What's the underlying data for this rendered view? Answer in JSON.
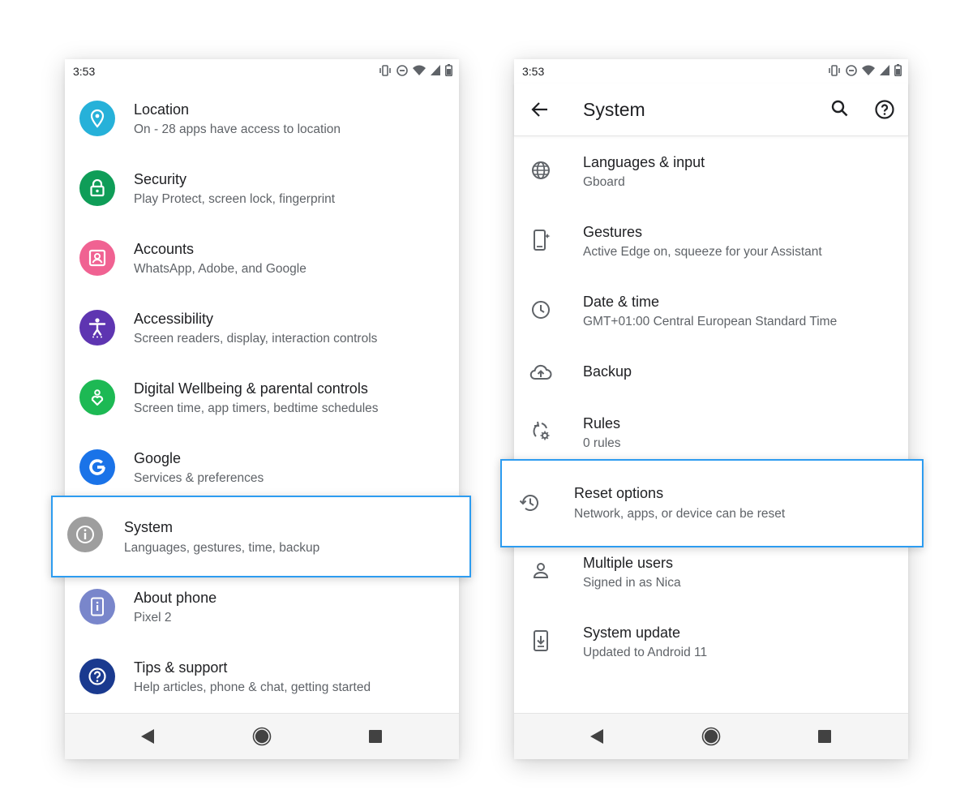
{
  "left_screen": {
    "status_time": "3:53",
    "items": [
      {
        "title": "Location",
        "subtitle": "On - 28 apps have access to location",
        "icon": "location-pin-icon",
        "color": "#26b1d9"
      },
      {
        "title": "Security",
        "subtitle": "Play Protect, screen lock, fingerprint",
        "icon": "lock-icon",
        "color": "#0f9d58"
      },
      {
        "title": "Accounts",
        "subtitle": "WhatsApp, Adobe, and Google",
        "icon": "account-box-icon",
        "color": "#f06292"
      },
      {
        "title": "Accessibility",
        "subtitle": "Screen readers, display, interaction controls",
        "icon": "accessibility-icon",
        "color": "#5e35b1"
      },
      {
        "title": "Digital Wellbeing & parental controls",
        "subtitle": "Screen time, app timers, bedtime schedules",
        "icon": "wellbeing-heart-icon",
        "color": "#1db954"
      },
      {
        "title": "Google",
        "subtitle": "Services & preferences",
        "icon": "google-g-icon",
        "color": "#1a73e8"
      },
      {
        "title": "System",
        "subtitle": "Languages, gestures, time, backup",
        "icon": "info-icon",
        "color": "#9e9e9e"
      },
      {
        "title": "About phone",
        "subtitle": "Pixel 2",
        "icon": "phone-info-icon",
        "color": "#7986cb"
      },
      {
        "title": "Tips & support",
        "subtitle": "Help articles, phone & chat, getting started",
        "icon": "help-icon",
        "color": "#1a3a8f"
      }
    ]
  },
  "right_screen": {
    "status_time": "3:53",
    "title": "System",
    "items": [
      {
        "title": "Languages & input",
        "subtitle": "Gboard",
        "icon": "globe-icon"
      },
      {
        "title": "Gestures",
        "subtitle": "Active Edge on, squeeze for your Assistant",
        "icon": "gesture-phone-icon"
      },
      {
        "title": "Date & time",
        "subtitle": "GMT+01:00 Central European Standard Time",
        "icon": "clock-icon"
      },
      {
        "title": "Backup",
        "subtitle": "",
        "icon": "cloud-upload-icon"
      },
      {
        "title": "Rules",
        "subtitle": "0 rules",
        "icon": "rules-icon"
      },
      {
        "title": "Reset options",
        "subtitle": "Network, apps, or device can be reset",
        "icon": "history-icon"
      },
      {
        "title": "Multiple users",
        "subtitle": "Signed in as Nica",
        "icon": "person-icon"
      },
      {
        "title": "System update",
        "subtitle": "Updated to Android 11",
        "icon": "system-update-icon"
      }
    ]
  },
  "colors": {
    "highlight": "#2d9cf0",
    "icon_gray": "#5f6368"
  }
}
